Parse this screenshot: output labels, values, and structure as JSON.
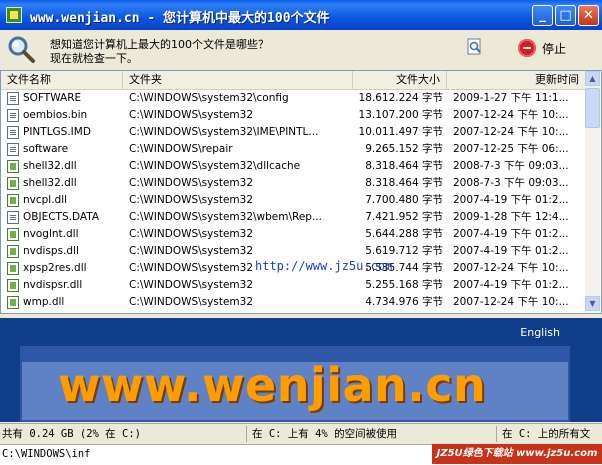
{
  "window": {
    "title": "www.wenjian.cn - 您计算机中最大的100个文件",
    "min_glyph": "_",
    "max_glyph": "□",
    "close_glyph": "✕"
  },
  "toolbar": {
    "question_line1": "想知道您计算机上最大的100个文件是哪些？",
    "question_line2": "现在就检查一下。",
    "search_icon": "search-page-icon",
    "stop_label": "停止",
    "stop_color": "#D71A1A"
  },
  "columns": [
    "文件名称",
    "文件夹",
    "文件大小",
    "更新时间"
  ],
  "files": [
    {
      "name": "SOFTWARE",
      "icon": "generic",
      "folder": "C:\\WINDOWS\\system32\\config",
      "size": "18.612.224 字节",
      "time": "2009-1-27 下午 11:1..."
    },
    {
      "name": "oembios.bin",
      "icon": "generic",
      "folder": "C:\\WINDOWS\\system32",
      "size": "13.107.200 字节",
      "time": "2007-12-24 下午 10:..."
    },
    {
      "name": "PINTLGS.IMD",
      "icon": "generic",
      "folder": "C:\\WINDOWS\\system32\\IME\\PINTL...",
      "size": "10.011.497 字节",
      "time": "2007-12-24 下午 10:..."
    },
    {
      "name": "software",
      "icon": "generic",
      "folder": "C:\\WINDOWS\\repair",
      "size": "9.265.152 字节",
      "time": "2007-12-25 下午 06:..."
    },
    {
      "name": "shell32.dll",
      "icon": "dll",
      "folder": "C:\\WINDOWS\\system32\\dllcache",
      "size": "8.318.464 字节",
      "time": "2008-7-3 下午 09:03..."
    },
    {
      "name": "shell32.dll",
      "icon": "dll",
      "folder": "C:\\WINDOWS\\system32",
      "size": "8.318.464 字节",
      "time": "2008-7-3 下午 09:03..."
    },
    {
      "name": "nvcpl.dll",
      "icon": "dll",
      "folder": "C:\\WINDOWS\\system32",
      "size": "7.700.480 字节",
      "time": "2007-4-19 下午 01:2..."
    },
    {
      "name": "OBJECTS.DATA",
      "icon": "generic",
      "folder": "C:\\WINDOWS\\system32\\wbem\\Rep...",
      "size": "7.421.952 字节",
      "time": "2009-1-28 下午 12:4..."
    },
    {
      "name": "nvoglnt.dll",
      "icon": "dll",
      "folder": "C:\\WINDOWS\\system32",
      "size": "5.644.288 字节",
      "time": "2007-4-19 下午 01:2..."
    },
    {
      "name": "nvdisps.dll",
      "icon": "dll",
      "folder": "C:\\WINDOWS\\system32",
      "size": "5.619.712 字节",
      "time": "2007-4-19 下午 01:2..."
    },
    {
      "name": "xpsp2res.dll",
      "icon": "dll",
      "folder": "C:\\WINDOWS\\system32",
      "size": "5.535.744 字节",
      "time": "2007-12-24 下午 10:..."
    },
    {
      "name": "nvdispsr.dll",
      "icon": "dll",
      "folder": "C:\\WINDOWS\\system32",
      "size": "5.255.168 字节",
      "time": "2007-4-19 下午 01:2..."
    },
    {
      "name": "wmp.dll",
      "icon": "dll",
      "folder": "C:\\WINDOWS\\system32",
      "size": "4.734.976 字节",
      "time": "2007-12-24 下午 10:..."
    }
  ],
  "overlay": {
    "link": "http://www.jz5u.com"
  },
  "banner": {
    "language": "English",
    "site": "www.wenjian.cn",
    "text_color": "#FF9C00"
  },
  "status": {
    "total": "共有 0.24 GB (2% 在 C:)",
    "used": "在 C: 上有 4% 的空间被使用",
    "all": "在 C: 上的所有文"
  },
  "path": {
    "current": "C:\\WINDOWS\\inf"
  },
  "brand": {
    "text": "JZ5U绿色下载站 www.jz5u.com"
  }
}
